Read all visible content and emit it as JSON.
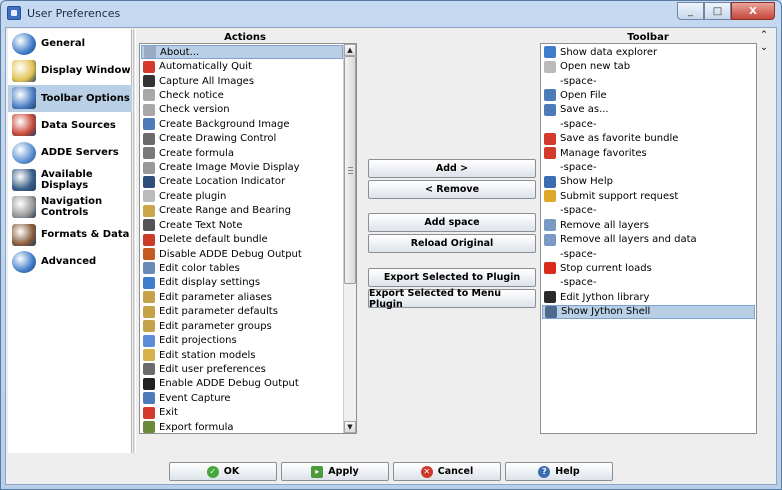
{
  "window": {
    "title": "User Preferences",
    "min_label": "_",
    "max_label": "□",
    "close_label": "X"
  },
  "sidebar": {
    "items": [
      {
        "label": "General",
        "icon": "general-globe-icon",
        "color": "#3f7cc9"
      },
      {
        "label": "Display Window",
        "icon": "display-window-icon",
        "color": "#e2c454"
      },
      {
        "label": "Toolbar Options",
        "icon": "toolbar-options-icon",
        "color": "#4d7fc4",
        "selected": true
      },
      {
        "label": "Data Sources",
        "icon": "data-sources-icon",
        "color": "#c94a3a"
      },
      {
        "label": "ADDE Servers",
        "icon": "adde-servers-icon",
        "color": "#5a8fd0"
      },
      {
        "label": "Available Displays",
        "icon": "available-displays-icon",
        "color": "#3b5f8a"
      },
      {
        "label": "Navigation Controls",
        "icon": "mouse-icon",
        "color": "#9a9a9a"
      },
      {
        "label": "Formats & Data",
        "icon": "formats-data-icon",
        "color": "#8a5d3a"
      },
      {
        "label": "Advanced",
        "icon": "advanced-globe-icon",
        "color": "#3f7cc9"
      }
    ]
  },
  "actions": {
    "header": "Actions",
    "items": [
      {
        "label": "About...",
        "icon": "about-icon",
        "color": "#9aa9c4",
        "selected": true
      },
      {
        "label": "Automatically Quit",
        "icon": "quit-icon",
        "color": "#d33a2c"
      },
      {
        "label": "Capture All Images",
        "icon": "camera-icon",
        "color": "#333333"
      },
      {
        "label": "Check notice",
        "icon": "check-notice-icon",
        "color": "#a8a8a8"
      },
      {
        "label": "Check version",
        "icon": "check-version-icon",
        "color": "#a8a8a8"
      },
      {
        "label": "Create Background Image",
        "icon": "background-image-icon",
        "color": "#4d7ab8"
      },
      {
        "label": "Create Drawing Control",
        "icon": "drawing-icon",
        "color": "#6b6b6b"
      },
      {
        "label": "Create formula",
        "icon": "formula-icon",
        "color": "#7a7a7a"
      },
      {
        "label": "Create Image Movie Display",
        "icon": "movie-icon",
        "color": "#9a9a9a"
      },
      {
        "label": "Create Location Indicator",
        "icon": "location-icon",
        "color": "#2f4f7a"
      },
      {
        "label": "Create plugin",
        "icon": "plugin-icon",
        "color": "#bbbbbb"
      },
      {
        "label": "Create Range and Bearing",
        "icon": "range-icon",
        "color": "#c9a64a"
      },
      {
        "label": "Create Text Note",
        "icon": "text-note-icon",
        "color": "#555555"
      },
      {
        "label": "Delete default bundle",
        "icon": "delete-bundle-icon",
        "color": "#cc3a2a"
      },
      {
        "label": "Disable ADDE Debug Output",
        "icon": "disable-debug-icon",
        "color": "#c45a1f"
      },
      {
        "label": "Edit color tables",
        "icon": "color-tables-icon",
        "color": "#6a8ab8"
      },
      {
        "label": "Edit display settings",
        "icon": "display-settings-icon",
        "color": "#3f7cc9"
      },
      {
        "label": "Edit parameter aliases",
        "icon": "param-aliases-icon",
        "color": "#c4a24a"
      },
      {
        "label": "Edit parameter defaults",
        "icon": "param-defaults-icon",
        "color": "#c4a24a"
      },
      {
        "label": "Edit parameter groups",
        "icon": "param-groups-icon",
        "color": "#c4a24a"
      },
      {
        "label": "Edit projections",
        "icon": "projections-icon",
        "color": "#5b8ed6"
      },
      {
        "label": "Edit station models",
        "icon": "station-models-icon",
        "color": "#d6b34a"
      },
      {
        "label": "Edit user preferences",
        "icon": "user-prefs-icon",
        "color": "#6b6b6b"
      },
      {
        "label": "Enable ADDE Debug Output",
        "icon": "enable-debug-icon",
        "color": "#222222"
      },
      {
        "label": "Event Capture",
        "icon": "event-capture-icon",
        "color": "#4d7ab8"
      },
      {
        "label": "Exit",
        "icon": "exit-icon",
        "color": "#d33a2c"
      },
      {
        "label": "Export formula",
        "icon": "export-formula-icon",
        "color": "#6b8a3a"
      }
    ]
  },
  "buttons_middle": {
    "add": "Add  >",
    "remove": "<  Remove",
    "add_space": "Add space",
    "reload": "Reload Original",
    "export_plugin": "Export Selected to Plugin",
    "export_menu": "Export Selected to Menu Plugin"
  },
  "toolbar": {
    "header": "Toolbar",
    "move_up": "⌃",
    "move_down": "⌄",
    "items": [
      {
        "label": "Show data explorer",
        "icon": "data-explorer-icon",
        "color": "#3f7cc9"
      },
      {
        "label": "Open new tab",
        "icon": "new-tab-icon",
        "color": "#bbbbbb"
      },
      {
        "label": "-space-",
        "space": true
      },
      {
        "label": "Open File",
        "icon": "open-file-icon",
        "color": "#4d7ab8"
      },
      {
        "label": "Save as...",
        "icon": "save-as-icon",
        "color": "#4d7ab8"
      },
      {
        "label": "-space-",
        "space": true
      },
      {
        "label": "Save as favorite bundle",
        "icon": "favorite-bundle-icon",
        "color": "#d33a2c"
      },
      {
        "label": "Manage favorites",
        "icon": "manage-favorites-icon",
        "color": "#d33a2c"
      },
      {
        "label": "-space-",
        "space": true
      },
      {
        "label": "Show Help",
        "icon": "help-icon",
        "color": "#3c6db0"
      },
      {
        "label": "Submit support request",
        "icon": "support-request-icon",
        "color": "#e0a82a"
      },
      {
        "label": "-space-",
        "space": true
      },
      {
        "label": "Remove all layers",
        "icon": "remove-layers-icon",
        "color": "#7a9ac4"
      },
      {
        "label": "Remove all layers and data",
        "icon": "remove-layers-data-icon",
        "color": "#7a9ac4"
      },
      {
        "label": "-space-",
        "space": true
      },
      {
        "label": "Stop current loads",
        "icon": "stop-loads-icon",
        "color": "#d92a1a"
      },
      {
        "label": "-space-",
        "space": true
      },
      {
        "label": "Edit Jython library",
        "icon": "jython-library-icon",
        "color": "#2a2a2a"
      },
      {
        "label": "Show Jython Shell",
        "icon": "jython-shell-icon",
        "color": "#4d6a8a",
        "selected": true
      }
    ]
  },
  "buttons_bottom": {
    "ok": "OK",
    "apply": "Apply",
    "cancel": "Cancel",
    "help": "Help"
  },
  "colors": {
    "selection": "#b8cfe5",
    "ok_icon": "#46a83a",
    "apply_icon": "#4d9a3a",
    "cancel_icon": "#cc3a2a",
    "help_icon": "#3c6db0"
  }
}
